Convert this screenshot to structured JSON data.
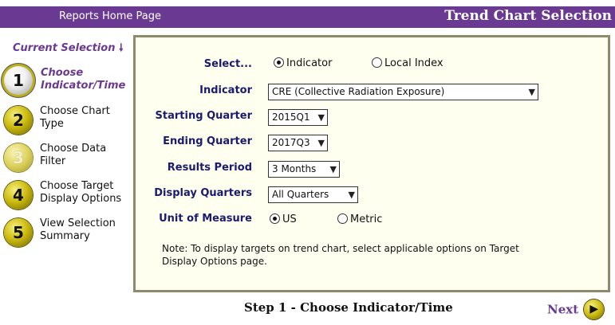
{
  "header": {
    "home_link": "Reports Home Page",
    "title": "Trend Chart Selection"
  },
  "sidebar": {
    "current_selection": "Current Selection",
    "arrow": "🠗",
    "steps": [
      {
        "number": "1",
        "line1": "Choose",
        "line2": "Indicator/Time",
        "state": "active"
      },
      {
        "number": "2",
        "line1": "Choose Chart",
        "line2": "Type",
        "state": "normal"
      },
      {
        "number": "3",
        "line1": "Choose Data",
        "line2": "Filter",
        "state": "disabled"
      },
      {
        "number": "4",
        "line1": "Choose Target",
        "line2": "Display Options",
        "state": "normal"
      },
      {
        "number": "5",
        "line1": "View Selection",
        "line2": "Summary",
        "state": "normal"
      }
    ]
  },
  "form": {
    "select_by": {
      "label": "Select...",
      "options": [
        "Indicator",
        "Local Index"
      ],
      "selected": "Indicator"
    },
    "indicator": {
      "label": "Indicator",
      "value": "CRE (Collective Radiation Exposure)"
    },
    "starting_quarter": {
      "label": "Starting Quarter",
      "value": "2015Q1"
    },
    "ending_quarter": {
      "label": "Ending Quarter",
      "value": "2017Q3"
    },
    "results_period": {
      "label": "Results Period",
      "value": "3 Months"
    },
    "display_quarters": {
      "label": "Display Quarters",
      "value": "All Quarters"
    },
    "unit_of_measure": {
      "label": "Unit of Measure",
      "options": [
        "US",
        "Metric"
      ],
      "selected": "US"
    },
    "note_line1": "Note: To display targets on trend chart, select applicable options on Target",
    "note_line2": "Display Options page."
  },
  "footer": {
    "step_title": "Step 1 - Choose Indicator/Time",
    "next_label": "Next",
    "next_icon": "▶"
  },
  "colors": {
    "header_bg": "#6a3a92",
    "label_color": "#1a1a6e",
    "panel_bg": "#fffff0",
    "gold": "#cdbc10"
  }
}
